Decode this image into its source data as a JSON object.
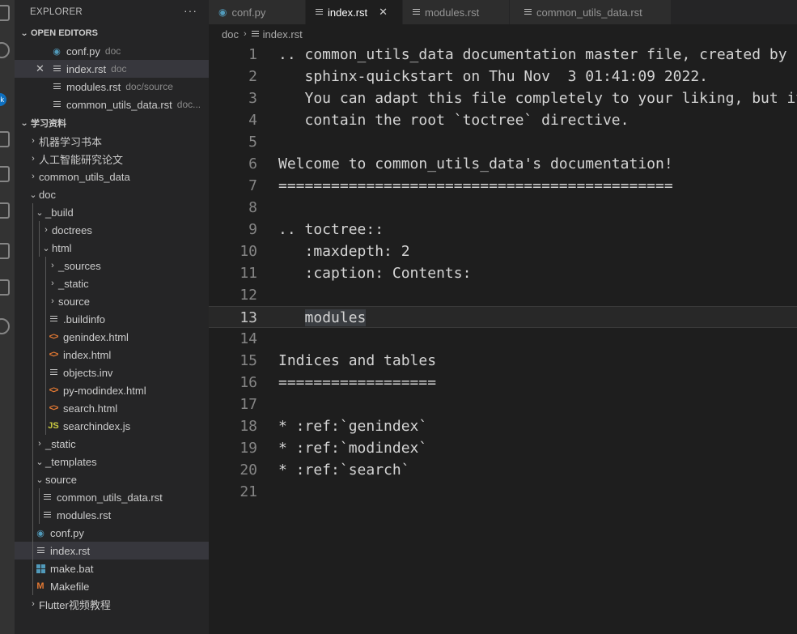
{
  "explorer": {
    "title": "EXPLORER",
    "more_actions": "···",
    "open_editors": {
      "header": "OPEN EDITORS",
      "items": [
        {
          "name": "conf.py",
          "desc": "doc",
          "icon": "python-file-icon"
        },
        {
          "name": "index.rst",
          "desc": "doc",
          "icon": "text-file-icon"
        },
        {
          "name": "modules.rst",
          "desc": "doc/source",
          "icon": "text-file-icon"
        },
        {
          "name": "common_utils_data.rst",
          "desc": "doc...",
          "icon": "text-file-icon"
        }
      ]
    },
    "folder": {
      "header": "学习资料",
      "tree": [
        {
          "name": "机器学习书本"
        },
        {
          "name": "人工智能研究论文"
        },
        {
          "name": "common_utils_data"
        },
        {
          "name": "doc"
        },
        {
          "name": "_build"
        },
        {
          "name": "doctrees"
        },
        {
          "name": "html"
        },
        {
          "name": "_sources"
        },
        {
          "name": "_static"
        },
        {
          "name": "source"
        },
        {
          "name": ".buildinfo"
        },
        {
          "name": "genindex.html"
        },
        {
          "name": "index.html"
        },
        {
          "name": "objects.inv"
        },
        {
          "name": "py-modindex.html"
        },
        {
          "name": "search.html"
        },
        {
          "name": "searchindex.js"
        },
        {
          "name": "_static"
        },
        {
          "name": "_templates"
        },
        {
          "name": "source"
        },
        {
          "name": "common_utils_data.rst"
        },
        {
          "name": "modules.rst"
        },
        {
          "name": "conf.py"
        },
        {
          "name": "index.rst"
        },
        {
          "name": "make.bat"
        },
        {
          "name": "Makefile"
        },
        {
          "name": "Flutter视频教程"
        }
      ]
    }
  },
  "tabs": [
    {
      "label": "conf.py",
      "icon": "python-file-icon"
    },
    {
      "label": "index.rst",
      "icon": "text-file-icon",
      "active": true
    },
    {
      "label": "modules.rst",
      "icon": "text-file-icon"
    },
    {
      "label": "common_utils_data.rst",
      "icon": "text-file-icon"
    }
  ],
  "breadcrumb": [
    "doc",
    "index.rst"
  ],
  "editor": {
    "current_line": 13,
    "lines": [
      ".. common_utils_data documentation master file, created by",
      "   sphinx-quickstart on Thu Nov  3 01:41:09 2022.",
      "   You can adapt this file completely to your liking, but it should at least",
      "   contain the root `toctree` directive.",
      "",
      "Welcome to common_utils_data's documentation!",
      "=============================================",
      "",
      ".. toctree::",
      "   :maxdepth: 2",
      "   :caption: Contents:",
      "",
      "   modules",
      "",
      "Indices and tables",
      "==================",
      "",
      "* :ref:`genindex`",
      "* :ref:`modindex`",
      "* :ref:`search`",
      ""
    ]
  },
  "colors": {
    "editor_bg": "#1e1e1e",
    "sidebar_bg": "#252526",
    "active_tab_bg": "#1e1e1e",
    "selection_bg": "#37373d"
  }
}
